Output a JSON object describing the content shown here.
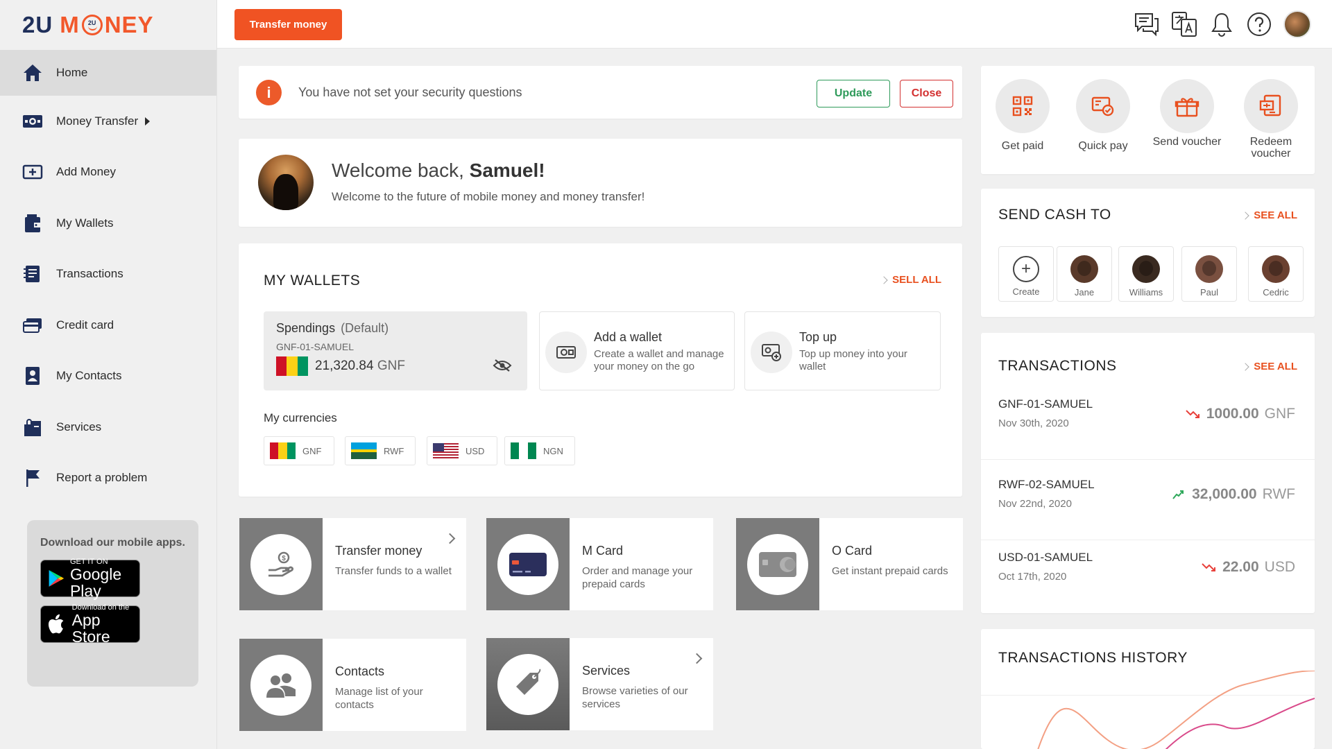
{
  "brand": {
    "name_part1": "2U",
    "name_part2": "M",
    "name_part3": "NEY",
    "logo_small": "2U"
  },
  "sidebar": {
    "items": [
      {
        "label": "Home",
        "icon": "home-icon"
      },
      {
        "label": "Money Transfer",
        "icon": "money-transfer-icon"
      },
      {
        "label": "Add Money",
        "icon": "add-money-icon"
      },
      {
        "label": "My Wallets",
        "icon": "wallet-icon"
      },
      {
        "label": "Transactions",
        "icon": "transactions-icon"
      },
      {
        "label": "Credit card",
        "icon": "credit-card-icon"
      },
      {
        "label": "My Contacts",
        "icon": "contacts-icon"
      },
      {
        "label": "Services",
        "icon": "services-icon"
      },
      {
        "label": "Report a problem",
        "icon": "flag-icon"
      }
    ],
    "download": {
      "title": "Download our mobile apps.",
      "google_small": "GET IT ON",
      "google_big": "Google Play",
      "apple_small": "Download on the",
      "apple_big": "App Store"
    }
  },
  "topbar": {
    "transfer_label": "Transfer money"
  },
  "alert": {
    "icon_text": "i",
    "message": "You have not set your security questions",
    "update_label": "Update",
    "close_label": "Close"
  },
  "welcome": {
    "greeting": "Welcome back, ",
    "name": "Samuel!",
    "subtitle": "Welcome to the future of mobile money and money transfer!"
  },
  "wallets": {
    "title": "MY WALLETS",
    "see_all": "SELL ALL",
    "default_wallet": {
      "name": "Spendings",
      "tag": "(Default)",
      "id": "GNF-01-SAMUEL",
      "amount": "21,320.84",
      "currency": "GNF"
    },
    "add_wallet": {
      "title": "Add a wallet",
      "desc": "Create a wallet and manage your money on the go"
    },
    "top_up": {
      "title": "Top up",
      "desc": "Top up money into your wallet"
    },
    "currencies_title": "My currencies",
    "currencies": [
      "GNF",
      "RWF",
      "USD",
      "NGN"
    ]
  },
  "tiles": [
    {
      "title": "Transfer money",
      "desc": "Transfer funds to a wallet"
    },
    {
      "title": "M Card",
      "desc": "Order and manage your prepaid cards"
    },
    {
      "title": "O Card",
      "desc": "Get instant prepaid cards"
    },
    {
      "title": "Contacts",
      "desc": "Manage list of your contacts"
    },
    {
      "title": "Services",
      "desc": "Browse varieties of our services"
    }
  ],
  "quick_actions": [
    {
      "label": "Get paid"
    },
    {
      "label": "Quick pay"
    },
    {
      "label": "Send voucher"
    },
    {
      "label": "Redeem voucher"
    }
  ],
  "send_cash": {
    "title": "SEND CASH TO",
    "see_all": "SEE ALL",
    "create_label": "Create",
    "contacts": [
      "Jane",
      "Williams",
      "Paul",
      "Cedric"
    ]
  },
  "transactions": {
    "title": "TRANSACTIONS",
    "see_all": "SEE ALL",
    "rows": [
      {
        "account": "GNF-01-SAMUEL",
        "date": "Nov 30th, 2020",
        "amount": "1000.00",
        "currency": "GNF",
        "direction": "down"
      },
      {
        "account": "RWF-02-SAMUEL",
        "date": "Nov 22nd, 2020",
        "amount": "32,000.00",
        "currency": "RWF",
        "direction": "up"
      },
      {
        "account": "USD-01-SAMUEL",
        "date": "Oct 17th, 2020",
        "amount": "22.00",
        "currency": "USD",
        "direction": "down"
      }
    ]
  },
  "history": {
    "title": "TRANSACTIONS HISTORY"
  },
  "colors": {
    "accent": "#f05323",
    "success": "#2e9a5a",
    "danger": "#d33030"
  }
}
